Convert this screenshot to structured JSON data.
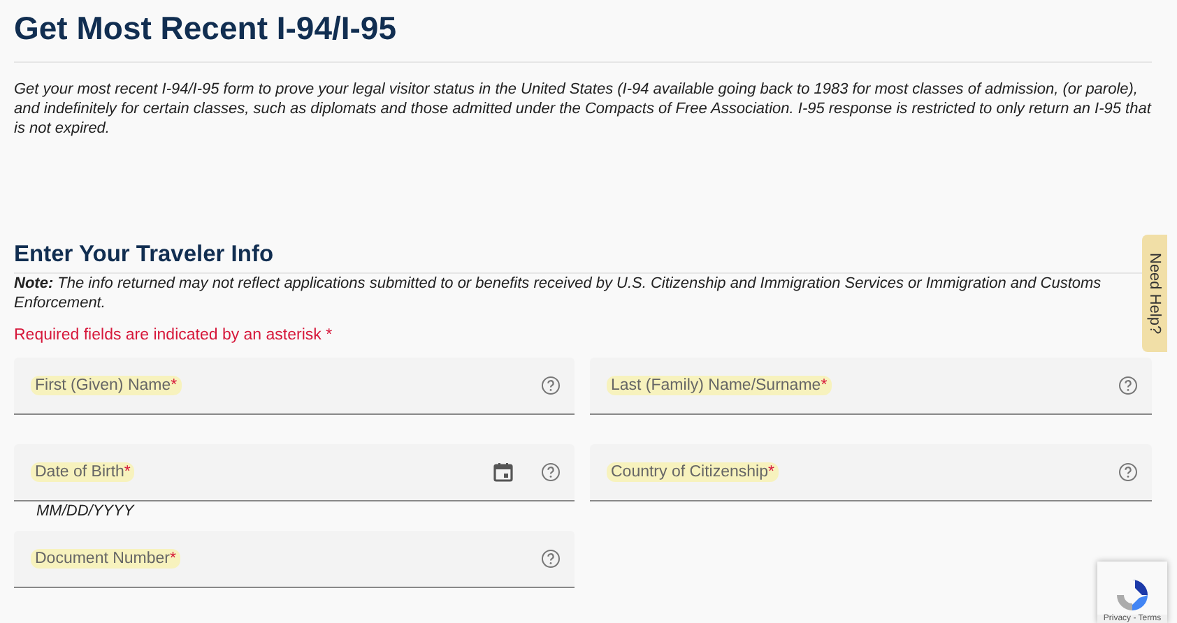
{
  "title": "Get Most Recent I-94/I-95",
  "intro": "Get your most recent I-94/I-95 form to prove your legal visitor status in the United States (I-94 available going back to 1983 for most classes of admission, (or parole), and indefinitely for certain classes, such as diplomats and those admitted under the Compacts of Free Association. I-95 response is restricted to only return an I-95 that is not expired.",
  "section_title": "Enter Your Traveler Info",
  "note": "**Note:** The info returned may not reflect applications submitted to or benefits received by U.S. Citizenship and Immigration Services or Immigration and Customs Enforcement.",
  "required_notice": "Required fields are indicated by an asterisk *",
  "fields": [
    {
      "kind": "text",
      "label": "First (Given) Name",
      "required_mark": "*"
    },
    {
      "kind": "text",
      "label": "Last (Family) Name/Surname",
      "required_mark": "*"
    },
    {
      "kind": "date",
      "label": "Date of Birth",
      "required_mark": "*",
      "hint": "MM/DD/YYYY"
    },
    {
      "kind": "text",
      "label": "Country of Citizenship",
      "required_mark": "*"
    },
    {
      "kind": "text",
      "label": "Document Number",
      "required_mark": "*"
    }
  ],
  "help_tab": "Need Help?",
  "recaptcha": {
    "links": "Privacy - Terms"
  }
}
